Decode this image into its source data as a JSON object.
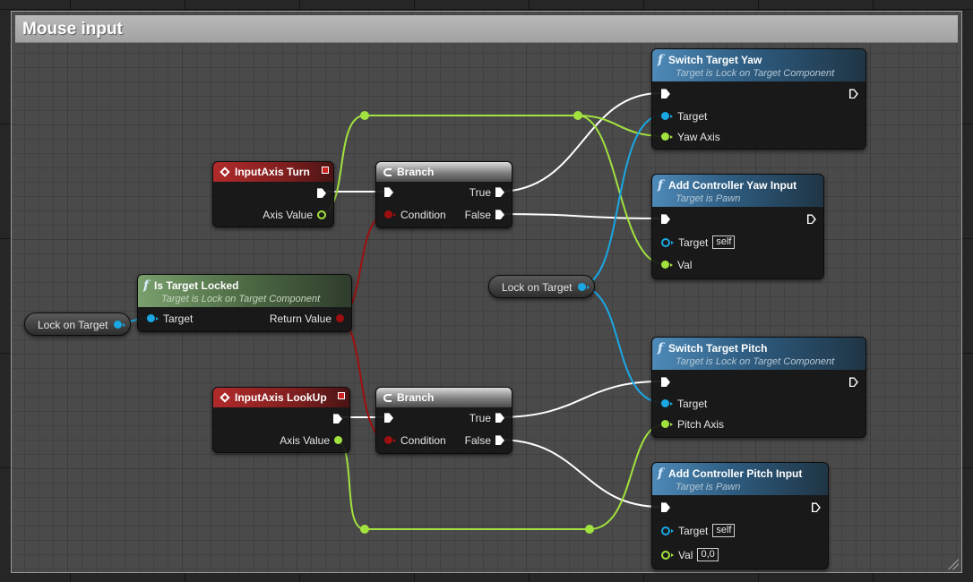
{
  "comment": {
    "title": "Mouse input"
  },
  "nodes": {
    "switch_yaw": {
      "title": "Switch Target Yaw",
      "subtitle": "Target is Lock on Target Component",
      "pins": [
        "Target",
        "Yaw Axis"
      ]
    },
    "add_yaw": {
      "title": "Add Controller Yaw Input",
      "subtitle": "Target is Pawn",
      "pins": [
        "Target",
        "Val"
      ],
      "target_default": "self"
    },
    "input_turn": {
      "title": "InputAxis Turn",
      "pins": [
        "Axis Value"
      ]
    },
    "branch_top": {
      "title": "Branch",
      "pins": [
        "Condition",
        "True",
        "False"
      ]
    },
    "is_target_locked": {
      "title": "Is Target Locked",
      "subtitle": "Target is Lock on Target Component",
      "pins": [
        "Target",
        "Return Value"
      ]
    },
    "input_lookup": {
      "title": "InputAxis LookUp",
      "pins": [
        "Axis Value"
      ]
    },
    "branch_bottom": {
      "title": "Branch",
      "pins": [
        "Condition",
        "True",
        "False"
      ]
    },
    "switch_pitch": {
      "title": "Switch Target Pitch",
      "subtitle": "Target is Lock on Target Component",
      "pins": [
        "Target",
        "Pitch Axis"
      ]
    },
    "add_pitch": {
      "title": "Add Controller Pitch Input",
      "subtitle": "Target is Pawn",
      "pins": [
        "Target",
        "Val"
      ],
      "target_default": "self",
      "val_default": "0,0"
    }
  },
  "variables": {
    "lock_left": "Lock on Target",
    "lock_mid": "Lock on Target"
  },
  "colors": {
    "exec": "#ffffff",
    "float": "#a2e23f",
    "object": "#1aa7e4",
    "bool": "#9e0f0f",
    "event_header": "#b12a2a",
    "function_header": "#4e8ab8",
    "pure_header": "#7aa06d"
  }
}
